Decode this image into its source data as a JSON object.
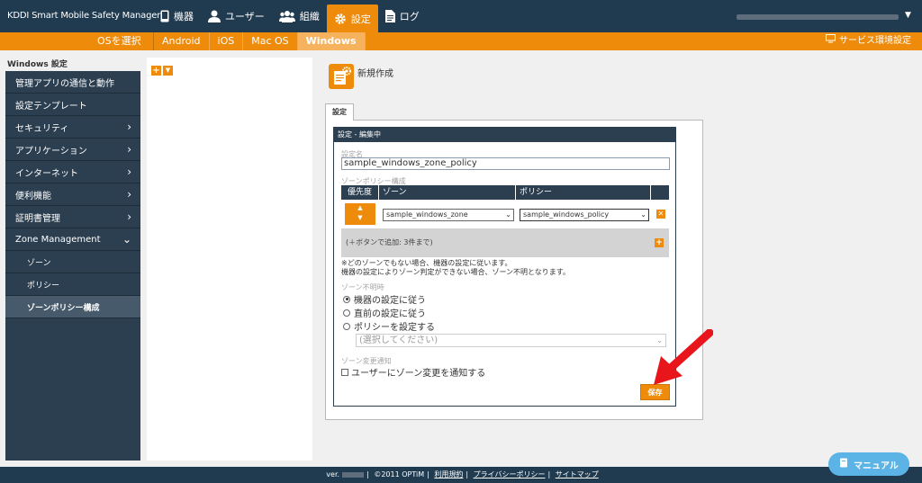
{
  "app": {
    "title": "KDDI Smart Mobile Safety Manager"
  },
  "nav": {
    "items": [
      {
        "label": "機器",
        "icon": "phone-icon"
      },
      {
        "label": "ユーザー",
        "icon": "user-icon"
      },
      {
        "label": "組織",
        "icon": "group-icon"
      },
      {
        "label": "設定",
        "icon": "gear-icon",
        "active": true
      },
      {
        "label": "ログ",
        "icon": "document-icon"
      }
    ]
  },
  "subbar": {
    "os_select": "OSを選択",
    "tabs": [
      "Android",
      "iOS",
      "Mac OS",
      "Windows"
    ],
    "active_tab": "Windows",
    "service_settings": "サービス環境設定"
  },
  "sidebar": {
    "title": "Windows 設定",
    "items": [
      {
        "label": "管理アプリの通信と動作",
        "chevron": ""
      },
      {
        "label": "設定テンプレート",
        "chevron": ""
      },
      {
        "label": "セキュリティ",
        "chevron": "›"
      },
      {
        "label": "アプリケーション",
        "chevron": "›"
      },
      {
        "label": "インターネット",
        "chevron": "›"
      },
      {
        "label": "便利機能",
        "chevron": "›"
      },
      {
        "label": "証明書管理",
        "chevron": "›"
      },
      {
        "label": "Zone Management",
        "chevron": "⌄"
      }
    ],
    "subitems": [
      {
        "label": "ゾーン"
      },
      {
        "label": "ポリシー"
      },
      {
        "label": "ゾーンポリシー構成",
        "active": true
      }
    ]
  },
  "main": {
    "new_title": "新規作成",
    "tab_label": "設定",
    "box_header": "設定 - 編集中",
    "name_label": "設定名",
    "name_value": "sample_windows_zone_policy",
    "zone_policy_label": "ゾーンポリシー構成",
    "table_headers": {
      "priority": "優先度",
      "zone": "ゾーン",
      "policy": "ポリシー"
    },
    "row": {
      "zone": "sample_windows_zone",
      "policy": "sample_windows_policy"
    },
    "add_hint": "(＋ボタンで追加: 3件まで)",
    "note_line1": "※どのゾーンでもない場合、機器の設定に従います。",
    "note_line2": "機器の設定によりゾーン判定ができない場合、ゾーン不明となります。",
    "zone_unknown_label": "ゾーン不明時",
    "radios": [
      {
        "label": "機器の設定に従う",
        "checked": true
      },
      {
        "label": "直前の設定に従う",
        "checked": false
      },
      {
        "label": "ポリシーを設定する",
        "checked": false
      }
    ],
    "policy_placeholder": "(選択してください)",
    "zone_change_label": "ゾーン変更通知",
    "notify_label": "ユーザーにゾーン変更を通知する",
    "save_label": "保存"
  },
  "footer": {
    "version_prefix": "ver.",
    "copyright": "©2011 OPTiM",
    "terms": "利用規約",
    "privacy": "プライバシーポリシー",
    "sitemap": "サイトマップ"
  },
  "manual_button": "マニュアル",
  "colors": {
    "accent": "#ef8b0a",
    "navy": "#203a4f",
    "sidebar": "#2c3f50",
    "manual": "#5bb4e5",
    "arrow": "#e8151b"
  }
}
